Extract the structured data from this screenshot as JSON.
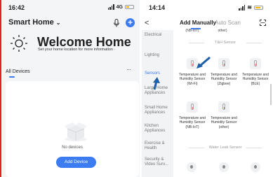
{
  "left": {
    "status_time": "16:42",
    "status_net": "4G",
    "home_title": "Smart Home",
    "welcome_title": "Welcome Home",
    "welcome_sub": "Set your home location for more information",
    "all_devices": "All Devices",
    "more": "···",
    "no_devices": "No devices",
    "add_device": "Add Device"
  },
  "right": {
    "status_time": "14:14",
    "back": "<",
    "tab_manual": "Add Manually",
    "tab_auto": "Auto Scan",
    "categories": [
      "Electrical",
      "Lighting",
      "Sensors",
      "Large Home Appliances",
      "Small Home Appliances",
      "Kitchen Appliances",
      "Exercise & Health",
      "Security & Video Surv..."
    ],
    "top_row": [
      "(NB-IoT)",
      "other)"
    ],
    "section_th": "T&H Sensor",
    "devices": [
      "Temperature and Humidity Sensor (Wi-Fi)",
      "Temperature and Humidity Sensor (Zigbee)",
      "Temperature and Humidity Sensor (BLE)",
      "Temperature and Humidity Sensor (NB-IoT)",
      "Temperature and Humidity Sensor (other)"
    ],
    "section_water": "Water Leak Sensor"
  },
  "colors": {
    "accent": "#3c7cf3",
    "divider": "#e2231a"
  }
}
